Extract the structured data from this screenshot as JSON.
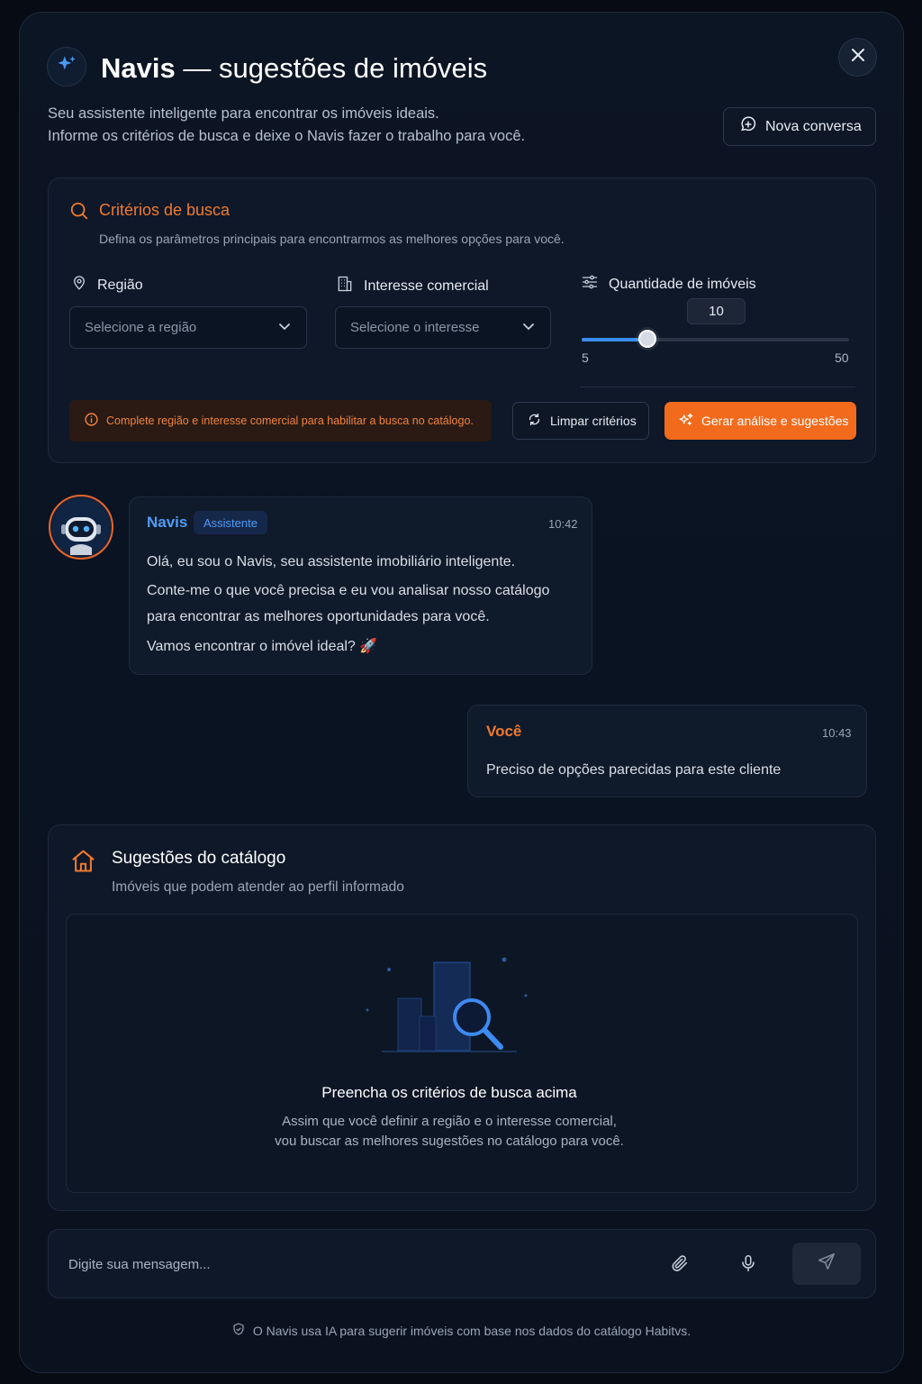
{
  "header": {
    "brand": "Navis",
    "title_rest": "— sugestões de imóveis",
    "subtitle_line1": "Seu assistente inteligente para encontrar os imóveis ideais.",
    "subtitle_line2": "Informe os critérios de busca e deixe o Navis fazer o trabalho para você.",
    "new_chat_label": "Nova conversa"
  },
  "criteria": {
    "title": "Critérios de busca",
    "description": "Defina os parâmetros principais para encontrarmos as melhores opções para você.",
    "region": {
      "label": "Região",
      "placeholder": "Selecione a região"
    },
    "interest": {
      "label": "Interesse comercial",
      "placeholder": "Selecione o interesse"
    },
    "quantity": {
      "label": "Quantidade de imóveis",
      "value": "10",
      "min": "5",
      "max": "50"
    },
    "warning": "Complete região e interesse comercial para habilitar a busca no catálogo.",
    "clear_label": "Limpar critérios",
    "generate_label": "Gerar análise e sugestões"
  },
  "messages": [
    {
      "author": "Navis",
      "badge": "Assistente",
      "time": "10:42",
      "lines": [
        "Olá, eu sou o Navis, seu assistente imobiliário inteligente.",
        "Conte-me o que você precisa e eu vou analisar nosso catálogo",
        "para encontrar as melhores oportunidades para você.",
        "Vamos encontrar o imóvel ideal? 🚀"
      ]
    },
    {
      "author": "Você",
      "time": "10:43",
      "lines": [
        "Preciso de opções parecidas para este cliente"
      ]
    }
  ],
  "suggestions": {
    "title": "Sugestões do catálogo",
    "description": "Imóveis que podem atender ao perfil informado",
    "empty_title": "Preencha os critérios de busca acima",
    "empty_line1": "Assim que você definir a região e o interesse comercial,",
    "empty_line2": "vou buscar as melhores sugestões no catálogo para você."
  },
  "composer": {
    "placeholder": "Digite sua mensagem..."
  },
  "footer": {
    "note": "O Navis usa IA para sugerir imóveis com base nos dados do catálogo Habitvs."
  },
  "icons": {
    "logo": "sparkles-icon",
    "close": "close-icon",
    "new_chat": "message-plus-icon",
    "search": "search-icon",
    "region": "map-pin-icon",
    "interest": "building-icon",
    "quantity": "sliders-icon",
    "chevron": "chevron-down-icon",
    "info": "info-icon",
    "refresh": "refresh-icon",
    "generate": "sparkles-icon",
    "home": "home-icon",
    "attach": "paperclip-icon",
    "mic": "microphone-icon",
    "send": "send-icon",
    "shield": "shield-check-icon"
  },
  "colors": {
    "accent_orange": "#f26b1d",
    "accent_blue": "#3b8df0",
    "background": "#0a1321"
  }
}
